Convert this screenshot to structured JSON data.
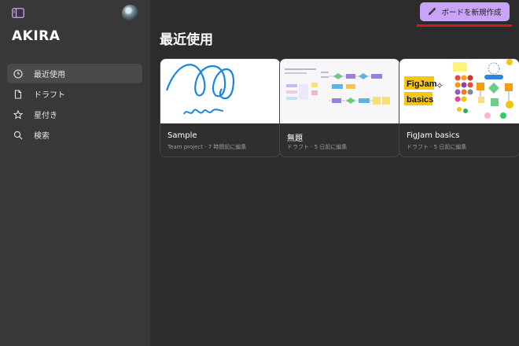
{
  "sidebar": {
    "user_name": "AKIRA",
    "items": [
      {
        "label": "最近使用",
        "icon": "clock-icon",
        "active": true
      },
      {
        "label": "ドラフト",
        "icon": "file-icon",
        "active": false
      },
      {
        "label": "星付き",
        "icon": "star-icon",
        "active": false
      },
      {
        "label": "検索",
        "icon": "search-icon",
        "active": false
      }
    ]
  },
  "header": {
    "new_board_label": "ボードを新規作成",
    "new_board_icon": "pen-icon"
  },
  "main": {
    "title": "最近使用",
    "files": [
      {
        "name": "Sample",
        "meta": "Team project · 7 時間前に編集"
      },
      {
        "name": "無題",
        "meta": "ドラフト · 5 日前に編集"
      },
      {
        "name": "FigJam basics",
        "meta": "ドラフト · 5 日前に編集",
        "thumb_text_1": "FigJam",
        "thumb_text_2": "basics"
      }
    ]
  },
  "colors": {
    "accent": "#c7a4f7",
    "background": "#2c2c2c",
    "sidebar": "#383838",
    "annotation": "#d11a1a"
  }
}
